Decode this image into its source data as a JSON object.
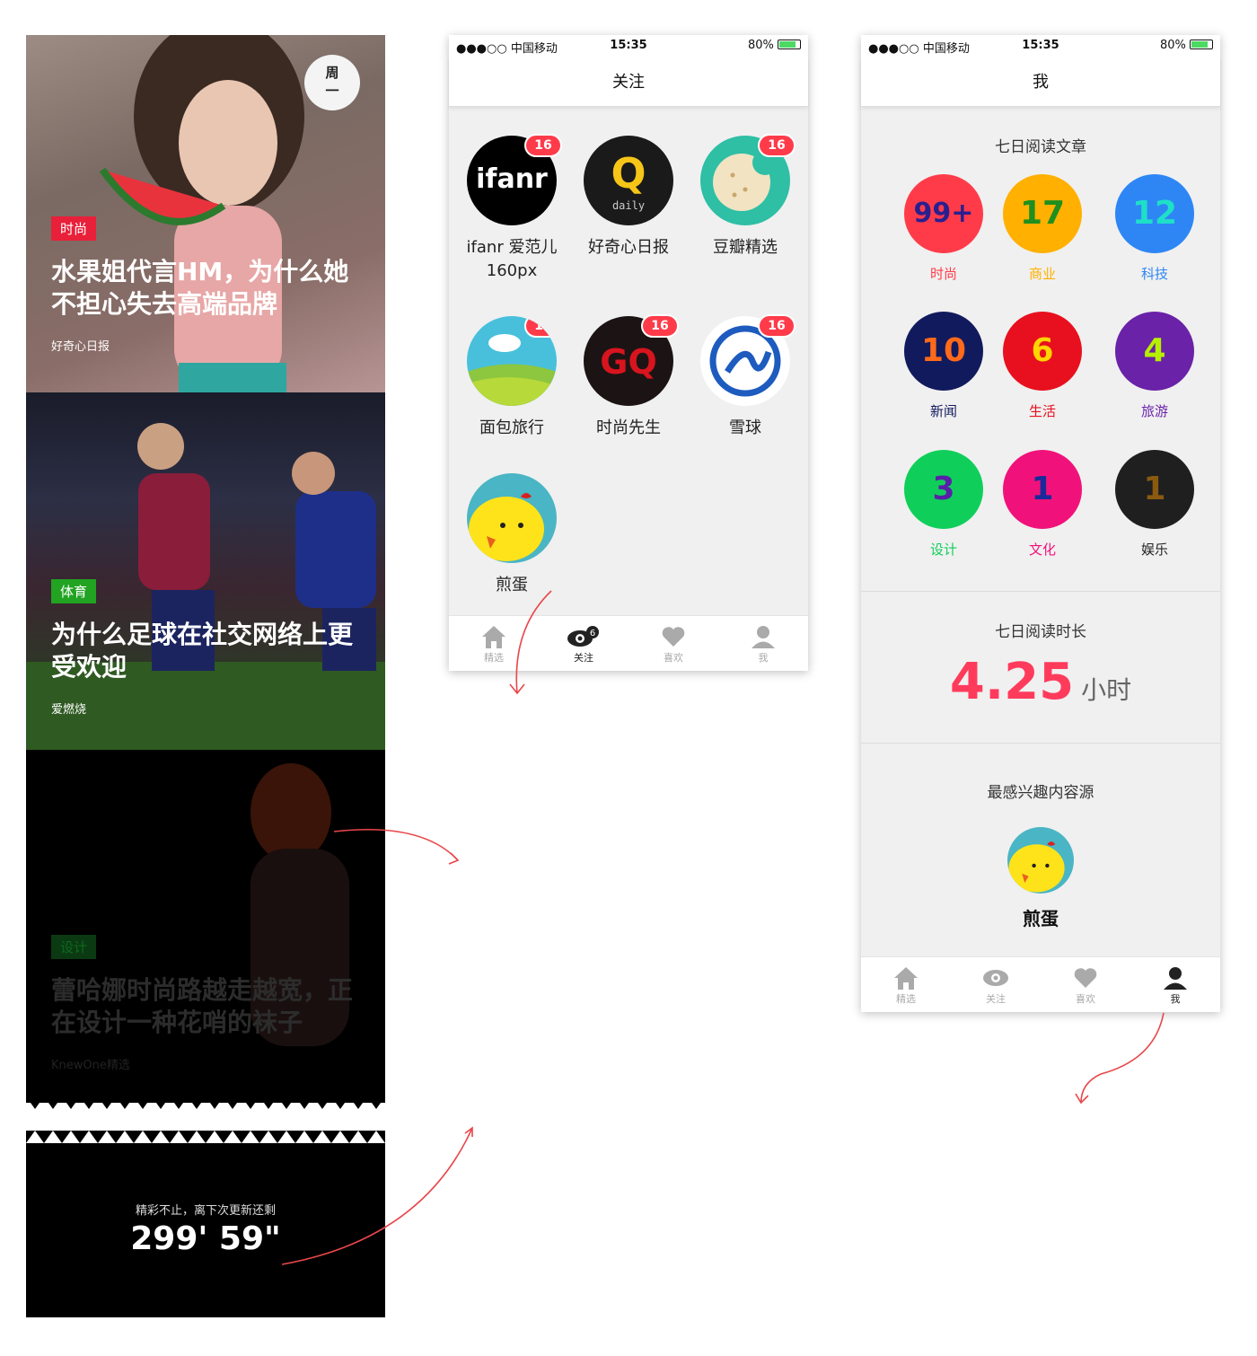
{
  "feed": {
    "week_badge": [
      "周",
      "一"
    ],
    "cards": [
      {
        "tag": "时尚",
        "tag_color": "#e8203a",
        "title": "水果姐代言HM，为什么她不担心失去高端品牌",
        "source": "好奇心日报"
      },
      {
        "tag": "体育",
        "tag_color": "#22a322",
        "title": "为什么足球在社交网络上更受欢迎",
        "source": "爱燃烧"
      },
      {
        "tag": "设计",
        "tag_color": "#0b3a12",
        "title": "蕾哈娜时尚路越走越宽，正在设计一种花哨的袜子",
        "source": "KnewOne精选"
      }
    ],
    "countdown_label": "精彩不止，离下次更新还剩",
    "countdown": "299' 59\""
  },
  "status_bar": {
    "carrier": "●●●○○ 中国移动",
    "time": "15:35",
    "battery": "80%"
  },
  "follow_screen": {
    "title": "关注",
    "sources": [
      {
        "name": "ifanr 爱范儿 160px",
        "badge": "16",
        "icon": "ifanr-logo"
      },
      {
        "name": "好奇心日报",
        "badge": "",
        "icon": "qdaily-logo"
      },
      {
        "name": "豆瓣精选",
        "badge": "16",
        "icon": "douban-cookie-logo"
      },
      {
        "name": "面包旅行",
        "badge": "16",
        "icon": "breadtrip-landscape-logo"
      },
      {
        "name": "时尚先生",
        "badge": "16",
        "icon": "gq-logo"
      },
      {
        "name": "雪球",
        "badge": "16",
        "icon": "xueqiu-logo"
      },
      {
        "name": "煎蛋",
        "badge": "",
        "icon": "jandan-chick-logo"
      }
    ],
    "tabs": [
      {
        "label": "精选",
        "icon": "home-icon"
      },
      {
        "label": "关注",
        "icon": "eye-icon",
        "badge": "6"
      },
      {
        "label": "喜欢",
        "icon": "heart-icon"
      },
      {
        "label": "我",
        "icon": "user-icon"
      }
    ]
  },
  "me_screen": {
    "title": "我",
    "weekly_articles_title": "七日阅读文章",
    "stats": [
      {
        "value": "99+",
        "label": "时尚",
        "bg": "#ff3b4a",
        "fg": "#2a1f8f",
        "label_color": "#ff3b4a"
      },
      {
        "value": "17",
        "label": "商业",
        "bg": "#ffb000",
        "fg": "#1f8f1f",
        "label_color": "#ffb000"
      },
      {
        "value": "12",
        "label": "科技",
        "bg": "#2e86f5",
        "fg": "#1ee0c8",
        "label_color": "#2e86f5"
      },
      {
        "value": "10",
        "label": "新闻",
        "bg": "#121a5e",
        "fg": "#ff6a1a",
        "label_color": "#121a5e"
      },
      {
        "value": "6",
        "label": "生活",
        "bg": "#e8101e",
        "fg": "#ffd400",
        "label_color": "#e8101e"
      },
      {
        "value": "4",
        "label": "旅游",
        "bg": "#6a22a8",
        "fg": "#b6f000",
        "label_color": "#6a22a8"
      },
      {
        "value": "3",
        "label": "设计",
        "bg": "#0fcf5a",
        "fg": "#5a1fa8",
        "label_color": "#0fcf5a"
      },
      {
        "value": "1",
        "label": "文化",
        "bg": "#f0127a",
        "fg": "#1a2a9a",
        "label_color": "#f0127a"
      },
      {
        "value": "1",
        "label": "娱乐",
        "bg": "#1f1f1f",
        "fg": "#8a5a10",
        "label_color": "#222222"
      }
    ],
    "weekly_time_title": "七日阅读时长",
    "weekly_time_value": "4.25",
    "weekly_time_unit": "小时",
    "favorite_title": "最感兴趣内容源",
    "favorite_name": "煎蛋",
    "tabs": [
      {
        "label": "精选",
        "icon": "home-icon"
      },
      {
        "label": "关注",
        "icon": "eye-icon"
      },
      {
        "label": "喜欢",
        "icon": "heart-icon"
      },
      {
        "label": "我",
        "icon": "user-icon"
      }
    ]
  },
  "colors": {
    "accent_red": "#ff3b5c",
    "arrow": "#e8474a"
  }
}
